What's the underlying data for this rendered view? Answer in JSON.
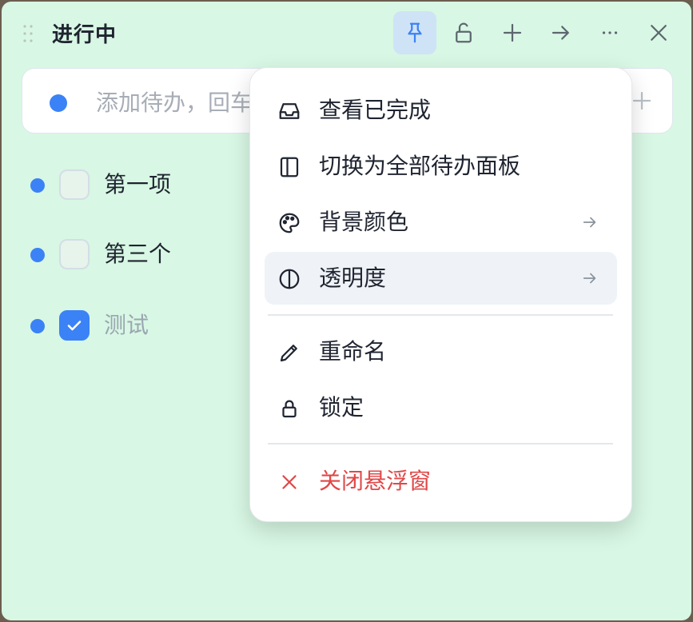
{
  "header": {
    "title": "进行中",
    "buttons": [
      "pin",
      "unlock",
      "add",
      "move",
      "more",
      "close"
    ]
  },
  "add_bar": {
    "placeholder": "添加待办，回车保存"
  },
  "todos": [
    {
      "label": "第一项",
      "checked": false
    },
    {
      "label": "第三个",
      "checked": false
    },
    {
      "label": "测试",
      "checked": true
    }
  ],
  "menu": {
    "items": [
      {
        "label": "查看已完成",
        "icon": "inbox-icon"
      },
      {
        "label": "切换为全部待办面板",
        "icon": "panel-icon"
      },
      {
        "label": "背景颜色",
        "icon": "palette-icon",
        "has_submenu": true
      },
      {
        "label": "透明度",
        "icon": "contrast-icon",
        "has_submenu": true,
        "highlighted": true
      },
      {
        "label": "重命名",
        "icon": "pencil-icon"
      },
      {
        "label": "锁定",
        "icon": "lock-icon"
      },
      {
        "label": "关闭悬浮窗",
        "icon": "close-icon",
        "danger": true
      }
    ]
  },
  "colors": {
    "background": "#d8f7e4",
    "accent": "#3b82f6",
    "danger": "#e04848",
    "text": "#1f2430"
  }
}
